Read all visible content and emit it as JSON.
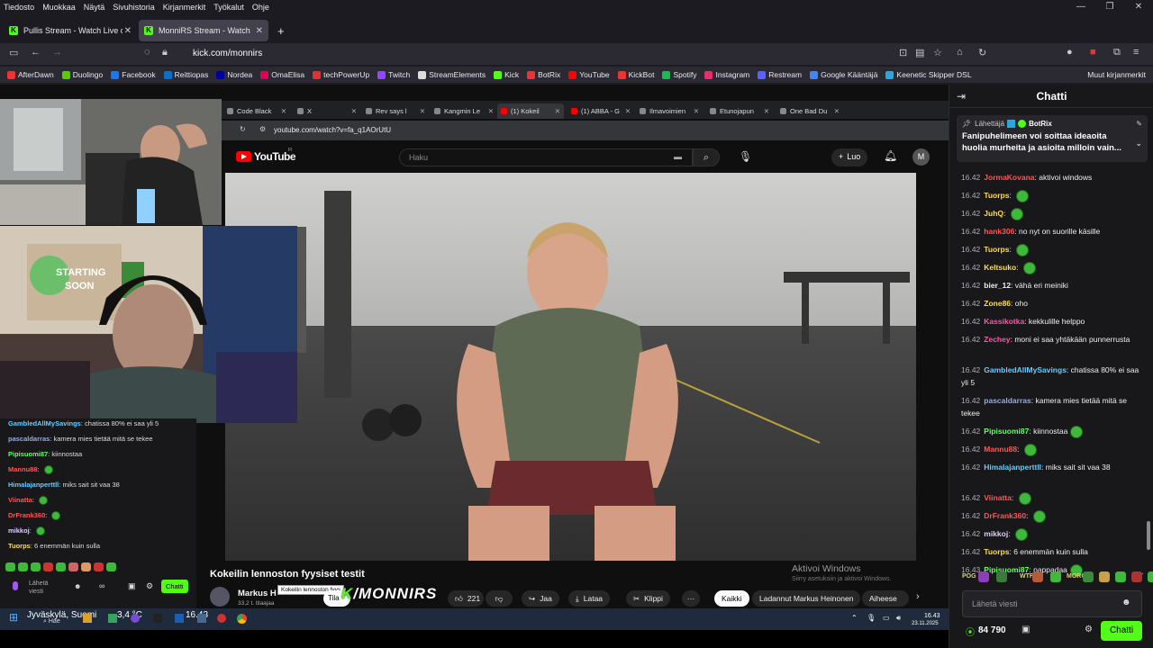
{
  "menu": [
    "Tiedosto",
    "Muokkaa",
    "Näytä",
    "Sivuhistoria",
    "Kirjanmerkit",
    "Työkalut",
    "Ohje"
  ],
  "tabs": [
    {
      "title": "Pullis Stream - Watch Live o",
      "active": false
    },
    {
      "title": "MonniRS Stream - Watch Li",
      "active": true
    }
  ],
  "new_tab": "+",
  "address": "kick.com/monnirs",
  "bookmarks": [
    {
      "label": "AfterDawn",
      "color": "#e33"
    },
    {
      "label": "Duolingo",
      "color": "#58cc02"
    },
    {
      "label": "Facebook",
      "color": "#1877f2"
    },
    {
      "label": "Reittiopas",
      "color": "#0a70c8"
    },
    {
      "label": "Nordea",
      "color": "#0000a0"
    },
    {
      "label": "OmaElisa",
      "color": "#e0005a"
    },
    {
      "label": "techPowerUp",
      "color": "#d33"
    },
    {
      "label": "Twitch",
      "color": "#9146ff"
    },
    {
      "label": "StreamElements",
      "color": "#ddd"
    },
    {
      "label": "Kick",
      "color": "#53fc18"
    },
    {
      "label": "BotRix",
      "color": "#e33"
    },
    {
      "label": "YouTube",
      "color": "#f00"
    },
    {
      "label": "KickBot",
      "color": "#e33"
    },
    {
      "label": "Spotify",
      "color": "#1db954"
    },
    {
      "label": "Instagram",
      "color": "#e1306c"
    },
    {
      "label": "Restream",
      "color": "#5563ff"
    },
    {
      "label": "Google Kääntäjä",
      "color": "#4285f4"
    },
    {
      "label": "Keenetic Skipper DSL",
      "color": "#2aa6e0"
    }
  ],
  "other_bookmarks": "Muut kirjanmerkit",
  "inner_tabs": [
    "Code Black",
    "X",
    "Rev says l",
    "Kangmin Le",
    "(1) Kokeil",
    "(1) ABBA - G",
    "Ilmavoimien",
    "Etunojapun",
    "One Bad Du"
  ],
  "inner_address": "youtube.com/watch?v=fa_q1AOrUtU",
  "youtube": {
    "logo": "YouTube",
    "region": "FI",
    "search_placeholder": "Haku",
    "create_label": "Luo",
    "avatar_letter": "M",
    "video_title": "Kokeilin lennoston fyysiset testit",
    "channel_name": "Markus H",
    "subscribers": "33,2 t. tilaajaa",
    "tooltip": "Kokeilin lennoston fyys",
    "subscribe_partial": "Tila",
    "likes": "221",
    "share_label": "Jaa",
    "download_label": "Lataa",
    "clip_label": "Klippi",
    "more_label": "···",
    "chips": [
      "Kaikki",
      "Ladannut Markus Heinonen",
      "Aiheese"
    ],
    "watermark": "/MONNIRS",
    "activate_title": "Aktivoi Windows",
    "activate_sub": "Siirry asetuksiin ja aktivoi Windows."
  },
  "minichat": [
    {
      "user": "GambledAllMySavings",
      "color": "#6cf",
      "text": "chatissa 80% ei saa yli 5"
    },
    {
      "user": "pascaldarras",
      "color": "#9ad",
      "text": "kamera mies tietää mitä se tekee"
    },
    {
      "user": "Pipisuomi87",
      "color": "#6f6",
      "text": "kiinnostaa"
    },
    {
      "user": "Mannu88",
      "color": "#f55",
      "text": ""
    },
    {
      "user": "Himalajanperttll",
      "color": "#6cf",
      "text": "miks sait sit vaa 38"
    },
    {
      "user": "Viinatta",
      "color": "#f55",
      "text": ""
    },
    {
      "user": "DrFrank360",
      "color": "#f55",
      "text": ""
    },
    {
      "user": "mikkoj",
      "color": "#dcf",
      "text": ""
    },
    {
      "user": "Tuorps",
      "color": "#fd5",
      "text": "6 enemmän kuin sulla"
    }
  ],
  "minichat_input": "Lähetä viesti",
  "minichat_send": "Chatti",
  "chat": {
    "title": "Chatti",
    "pinned_by_prefix": "Lähettäjä",
    "pinned_by": "BotRix",
    "pinned_text": "Fanipuhelimeen voi soittaa ideaoita huolia murheita ja asioita milloin vain...",
    "messages": [
      {
        "time": "16.42",
        "user": "JormaKovana",
        "color": "#f55",
        "text": "aktivoi windows",
        "emote": false
      },
      {
        "time": "16.42",
        "user": "Tuorps",
        "color": "#fd5",
        "text": "",
        "emote": true
      },
      {
        "time": "16.42",
        "user": "JuhQ",
        "color": "#fd5",
        "text": "",
        "emote": true
      },
      {
        "time": "16.42",
        "user": "hank306",
        "color": "#f55",
        "text": "no nyt on suorille käsille",
        "emote": false
      },
      {
        "time": "16.42",
        "user": "Tuorps",
        "color": "#fd5",
        "text": "",
        "emote": true
      },
      {
        "time": "16.42",
        "user": "Keltsuko",
        "color": "#fd5",
        "text": "",
        "emote": true
      },
      {
        "time": "16.42",
        "user": "bier_12",
        "color": "#efeff1",
        "text": "vähä eri meiniki",
        "emote": false
      },
      {
        "time": "16.42",
        "user": "Zone86",
        "color": "#fd5",
        "text": "oho",
        "emote": false
      },
      {
        "time": "16.42",
        "user": "Kassikotka",
        "color": "#f5a",
        "text": "kekkulille helppo",
        "emote": false
      },
      {
        "time": "16.42",
        "user": "Zechey",
        "color": "#f5a",
        "text": "moni ei saa yhtäkään punnerrusta",
        "emote": false
      },
      {
        "time": "16.42",
        "user": "GambledAllMySavings",
        "color": "#6cf",
        "text": "chatissa 80% ei saa yli 5",
        "emote": false
      },
      {
        "time": "16.42",
        "user": "pascaldarras",
        "color": "#9ad",
        "text": "kamera mies tietää mitä se tekee",
        "emote": false
      },
      {
        "time": "16.42",
        "user": "Pipisuomi87",
        "color": "#6f6",
        "text": "kiinnostaa",
        "emote": true
      },
      {
        "time": "16.42",
        "user": "Mannu88",
        "color": "#f55",
        "text": "",
        "emote": true
      },
      {
        "time": "16.42",
        "user": "Himalajanperttll",
        "color": "#6cf",
        "text": "miks sait sit vaa 38",
        "emote": false
      },
      {
        "time": "16.42",
        "user": "Viinatta",
        "color": "#f55",
        "text": "",
        "emote": true
      },
      {
        "time": "16.42",
        "user": "DrFrank360",
        "color": "#f55",
        "text": "",
        "emote": true
      },
      {
        "time": "16.42",
        "user": "mikkoj",
        "color": "#dcf",
        "text": "",
        "emote": true
      },
      {
        "time": "16.42",
        "user": "Tuorps",
        "color": "#fd5",
        "text": "6 enemmän kuin sulla",
        "emote": false
      },
      {
        "time": "16.43",
        "user": "Pipisuomi87",
        "color": "#6f6",
        "text": "pappadaa",
        "emote": true
      }
    ],
    "emote_bar": [
      "POG",
      "WTF",
      "MORO",
      "SIT"
    ],
    "input_placeholder": "Lähetä viesti",
    "points": "84 790",
    "send_label": "Chatti"
  },
  "taskbar": {
    "location": "Jyväskylä, Suomi",
    "weather": "3,4 °C",
    "search": "Hae",
    "clock": "16.43",
    "date": "23.11.2025",
    "overlay_clock": "16.43"
  },
  "colors": {
    "kick_green": "#53fc18",
    "yt_red": "#ff0000",
    "chat_bg": "#18181b"
  }
}
